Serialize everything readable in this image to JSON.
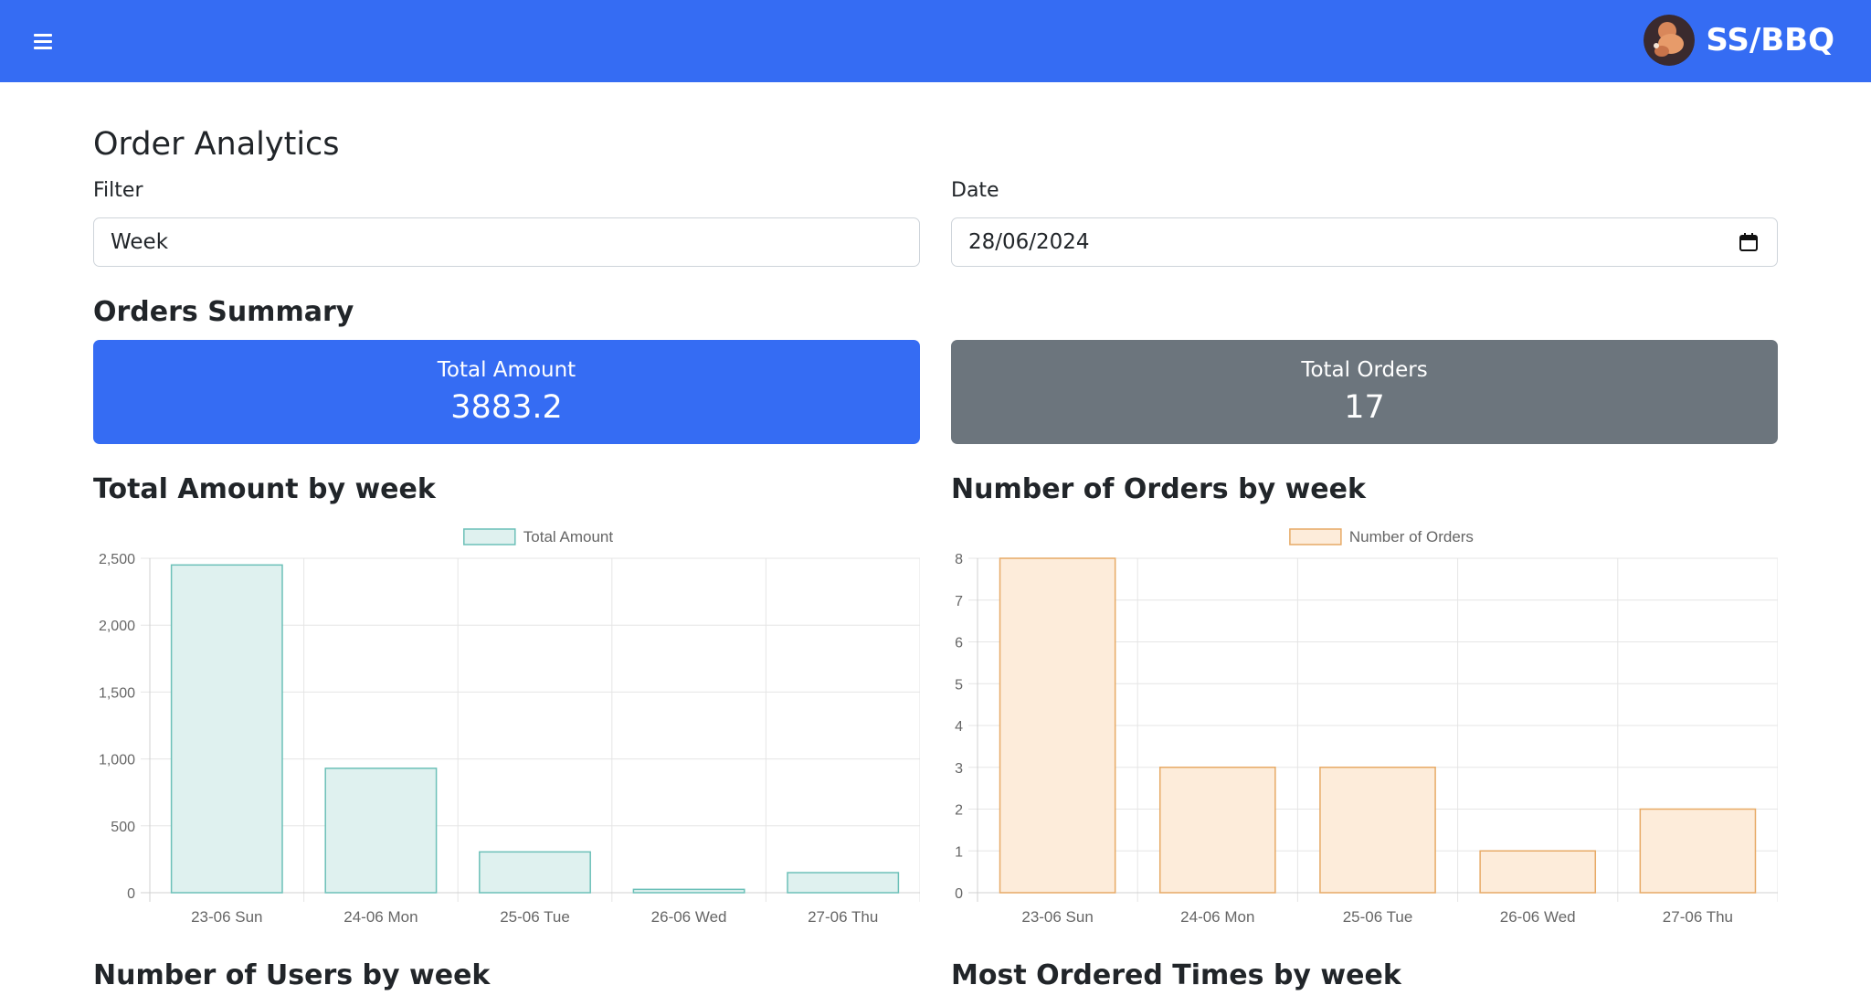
{
  "navbar": {
    "brand": "SS/BBQ",
    "menu_icon": "hamburger-icon",
    "logo_icon": "bbq-logo-icon"
  },
  "page": {
    "title": "Order Analytics"
  },
  "filters": {
    "filter_label": "Filter",
    "filter_value": "Week",
    "date_label": "Date",
    "date_value": "28/06/2024"
  },
  "summary": {
    "title": "Orders Summary",
    "total_amount_label": "Total Amount",
    "total_amount_value": "3883.2",
    "total_orders_label": "Total Orders",
    "total_orders_value": "17"
  },
  "sections": {
    "amount_chart_title": "Total Amount by week",
    "orders_chart_title": "Number of Orders by week",
    "users_chart_title": "Number of Users by week",
    "times_chart_title": "Most Ordered Times by week"
  },
  "colors": {
    "primary": "#356cf3",
    "secondary": "#6c757d",
    "teal_fill": "#dff1ef",
    "teal_stroke": "#6cc0b8",
    "orange_fill": "#fdecda",
    "orange_stroke": "#e7aa66"
  },
  "chart_data": [
    {
      "type": "bar",
      "categories": [
        "23-06 Sun",
        "24-06 Mon",
        "25-06 Tue",
        "26-06 Wed",
        "27-06 Thu"
      ],
      "series": [
        {
          "name": "Total Amount",
          "values": [
            2450,
            930,
            305,
            25,
            150
          ]
        }
      ],
      "ylim": [
        0,
        2500
      ],
      "yticks": [
        0,
        500,
        1000,
        1500,
        2000,
        2500
      ],
      "ytick_labels": [
        "0",
        "500",
        "1,000",
        "1,500",
        "2,000",
        "2,500"
      ],
      "legend": "top-center",
      "grid": true
    },
    {
      "type": "bar",
      "categories": [
        "23-06 Sun",
        "24-06 Mon",
        "25-06 Tue",
        "26-06 Wed",
        "27-06 Thu"
      ],
      "series": [
        {
          "name": "Number of Orders",
          "values": [
            8,
            3,
            3,
            1,
            2
          ]
        }
      ],
      "ylim": [
        0,
        8
      ],
      "yticks": [
        0,
        1,
        2,
        3,
        4,
        5,
        6,
        7,
        8
      ],
      "ytick_labels": [
        "0",
        "1",
        "2",
        "3",
        "4",
        "5",
        "6",
        "7",
        "8"
      ],
      "legend": "top-center",
      "grid": true
    }
  ]
}
